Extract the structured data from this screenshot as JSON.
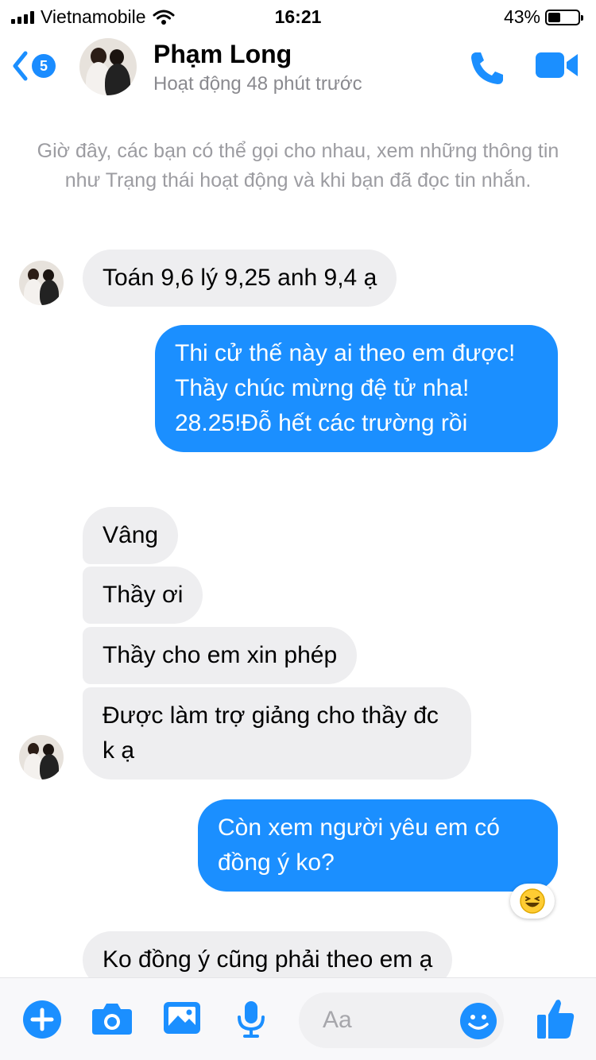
{
  "status_bar": {
    "carrier": "Vietnamobile",
    "time": "16:21",
    "battery": "43%",
    "battery_level": 0.43
  },
  "header": {
    "back_count": "5",
    "name": "Phạm Long",
    "status": "Hoạt động 48 phút trước",
    "icons": [
      "back-chevron-icon",
      "phone-icon",
      "video-icon"
    ]
  },
  "info_text": "Giờ đây, các bạn có thể gọi cho nhau, xem những thông tin như Trạng thái hoạt động và khi bạn đã đọc tin nhắn.",
  "messages": [
    {
      "from": "them",
      "text": "Toán 9,6 lý 9,25 anh 9,4 ạ"
    },
    {
      "from": "me",
      "text": "Thi cử thế này ai theo em được! Thầy chúc mừng đệ tử nha! 28.25!Đỗ hết các trường rồi"
    },
    {
      "from": "them",
      "text": "Vâng"
    },
    {
      "from": "them",
      "text": "Thầy ơi"
    },
    {
      "from": "them",
      "text": "Thầy cho em xin phép"
    },
    {
      "from": "them",
      "text": "Được làm trợ giảng cho thầy đc k ạ"
    },
    {
      "from": "me",
      "text": "Còn xem người yêu em có đồng ý ko?",
      "reaction": "laughing-emoji"
    },
    {
      "from": "them",
      "text": "Ko đồng ý cũng phải theo em ạ"
    }
  ],
  "composer": {
    "placeholder": "Aa",
    "icons": [
      "plus-icon",
      "camera-icon",
      "image-icon",
      "microphone-icon",
      "emoji-icon",
      "thumbs-up-icon"
    ]
  },
  "colors": {
    "accent": "#1b8fff",
    "incoming_bubble": "#eeeef0",
    "secondary_text": "#8a8a8f"
  }
}
